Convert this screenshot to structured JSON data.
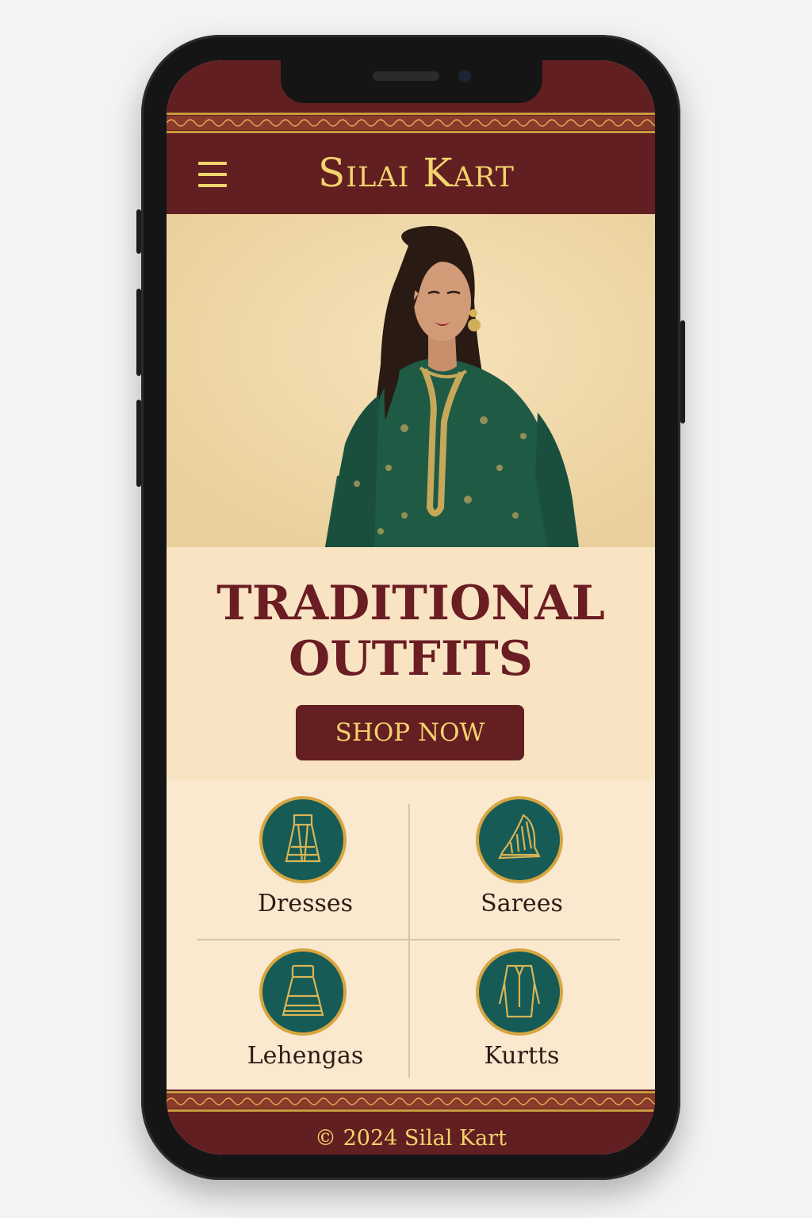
{
  "header": {
    "brand": "Silai Kart",
    "menu_icon": "hamburger-menu-icon"
  },
  "hero": {
    "image_icon": "model-in-green-kurta",
    "headline_line1": "TRADITIONAL",
    "headline_line2": "OUTFITS",
    "cta_label": "SHOP NOW"
  },
  "categories": [
    {
      "label": "Dresses",
      "icon": "dress-icon"
    },
    {
      "label": "Sarees",
      "icon": "saree-icon"
    },
    {
      "label": "Lehengas",
      "icon": "lehenga-icon"
    },
    {
      "label": "Kurtts",
      "icon": "kurta-icon"
    }
  ],
  "footer": {
    "text": "© 2024 Silal Kart"
  },
  "colors": {
    "maroon": "#621f22",
    "gold": "#f2d46c",
    "teal": "#165b56",
    "cream": "#f8e3c2",
    "beige": "#f2d9a9"
  }
}
